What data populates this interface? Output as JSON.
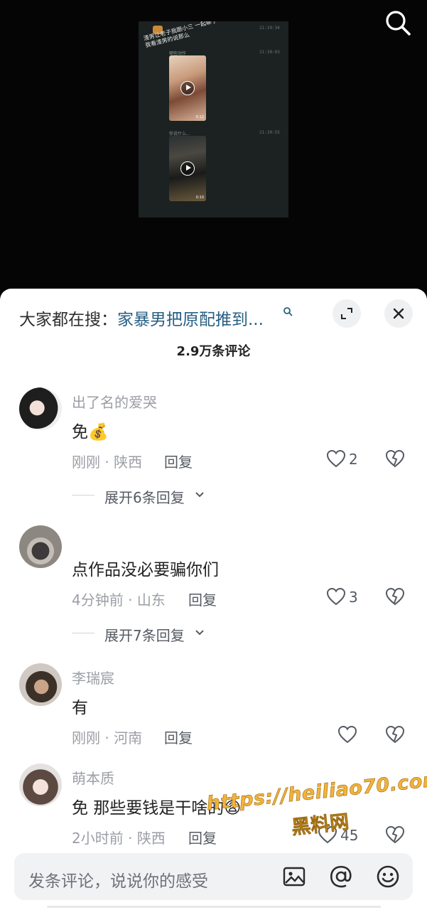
{
  "video": {
    "caption": "渣男让老子我跟小三 一起聊了我看渣男的说那么",
    "times": [
      "21:29:34",
      "21:30:03",
      "21:30:55"
    ],
    "clip_labels": [
      "哪些动作",
      "你说什么..."
    ],
    "durations": [
      "0:12",
      "0:10"
    ]
  },
  "panel": {
    "search_prefix": "大家都在搜：",
    "search_query": "家暴男把原配推到...",
    "comment_count_title": "2.9万条评论"
  },
  "comments": [
    {
      "user": "出了名的爱哭",
      "text": "免",
      "emoji": "💰",
      "time": "刚刚",
      "location": "陕西",
      "reply": "回复",
      "likes": "2",
      "expand": "展开6条回复"
    },
    {
      "user": "",
      "text": "点作品没必要骗你们",
      "time": "4分钟前",
      "location": "山东",
      "reply": "回复",
      "likes": "3",
      "expand": "展开7条回复"
    },
    {
      "user": "李瑞宸",
      "text": "有",
      "time": "刚刚",
      "location": "河南",
      "reply": "回复",
      "likes": ""
    },
    {
      "user": "萌本质",
      "text": "免 那些要钱是干啥的",
      "emoji": "😩",
      "time": "2小时前",
      "location": "陕西",
      "reply": "回复",
      "likes": "45"
    }
  ],
  "watermark": {
    "url": "https://heiliao70.com",
    "name": "黑料网"
  },
  "input": {
    "placeholder": "发条评论，说说你的感受"
  },
  "icons": [
    "search-icon",
    "search-mini-icon",
    "expand-icon",
    "close-icon",
    "heart-icon",
    "dislike-heart-icon",
    "chevron-down-icon",
    "image-icon",
    "at-icon",
    "emoji-icon",
    "play-icon"
  ],
  "colors": {
    "link": "#275f83",
    "meta": "#9b9ea5",
    "watermark": "#f3b33a",
    "panel_bg": "#ffffff",
    "input_bg": "#f1f2f4"
  }
}
